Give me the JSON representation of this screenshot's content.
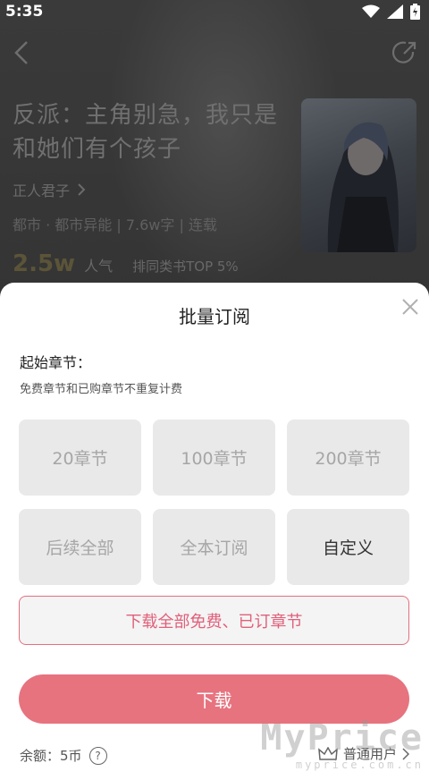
{
  "status_bar": {
    "time": "5:35"
  },
  "book": {
    "title": "反派：主角别急，我只是和她们有个孩子",
    "author": "正人君子",
    "meta": "都市 · 都市异能 | 7.6w字 | 连载",
    "popularity_value": "2.5w",
    "popularity_label": "人气",
    "rank": "排同类书TOP 5%"
  },
  "sheet": {
    "title": "批量订阅",
    "start_label": "起始章节：",
    "note": "免费章节和已购章节不重复计费",
    "options": [
      {
        "label": "20章节",
        "active": false
      },
      {
        "label": "100章节",
        "active": false
      },
      {
        "label": "200章节",
        "active": false
      },
      {
        "label": "后续全部",
        "active": false
      },
      {
        "label": "全本订阅",
        "active": false
      },
      {
        "label": "自定义",
        "active": true
      }
    ],
    "download_free_label": "下载全部免费、已订章节",
    "download_label": "下载",
    "balance": "余额：5币",
    "user_tier": "普通用户"
  },
  "watermark": {
    "main": "MyPrice",
    "sub": "myprice.com.cn"
  },
  "colors": {
    "accent": "#e7737f",
    "accent_text": "#e0607a",
    "option_bg": "#e9e9e9"
  },
  "icons": [
    "wifi-icon",
    "signal-icon",
    "battery-icon",
    "back-icon",
    "share-icon",
    "close-icon",
    "chevron-right-icon",
    "help-icon",
    "crown-icon"
  ]
}
